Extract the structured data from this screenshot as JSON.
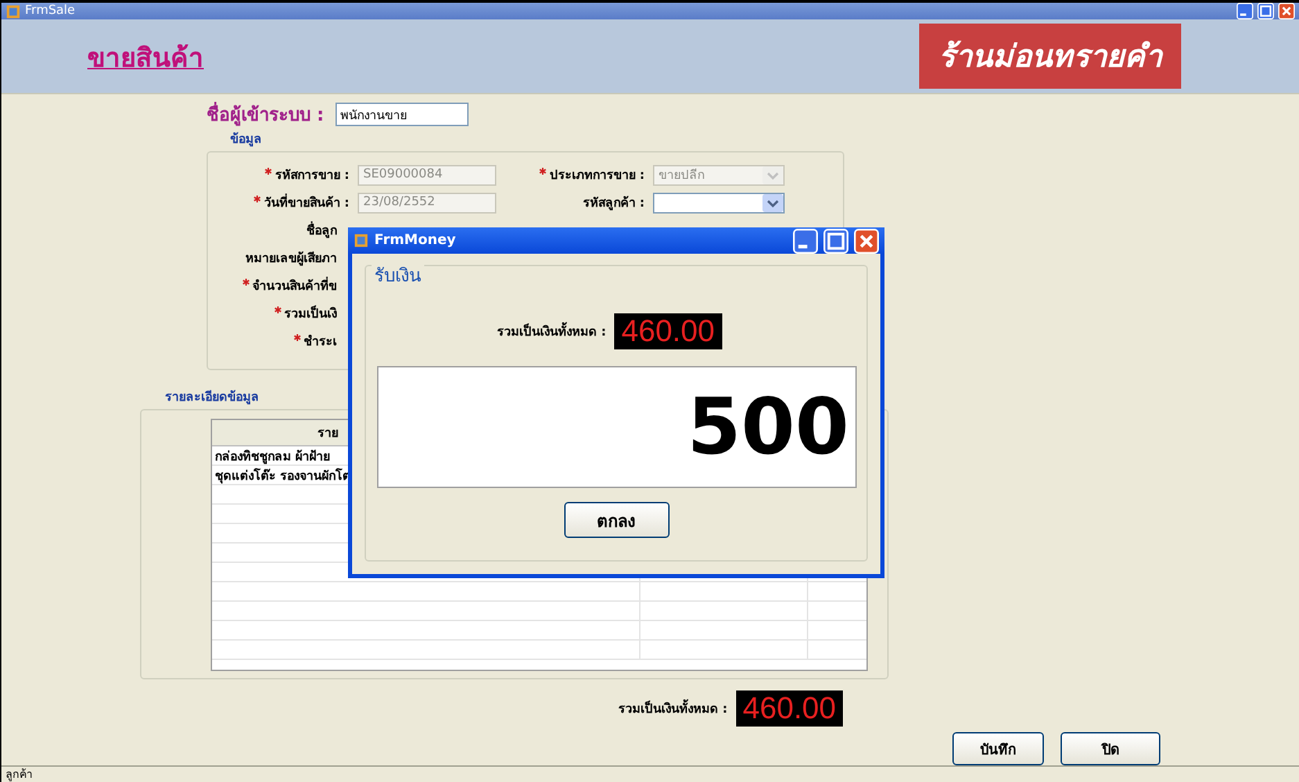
{
  "window": {
    "title": "FrmSale"
  },
  "banner": {
    "title": "ขายสินค้า",
    "shop_name": "ร้านม่อนทรายคำ"
  },
  "login": {
    "label": "ชื่อผู้เข้าระบบ :",
    "value": "พนักงานขาย"
  },
  "info_group": {
    "title": "ข้อมูล",
    "left_rows": [
      {
        "label": "รหัสการขาย :",
        "required": true,
        "value": "SE09000084",
        "disabled": true
      },
      {
        "label": "วันที่ขายสินค้า :",
        "required": true,
        "value": "23/08/2552",
        "disabled": true
      },
      {
        "label": "ชื่อลูก",
        "required": false
      },
      {
        "label": "หมายเลขผู้เสียภา",
        "required": false
      },
      {
        "label": "จำนวนสินค้าที่ข",
        "required": true
      },
      {
        "label": "รวมเป็นเงิ",
        "required": true
      },
      {
        "label": "ชำระเ",
        "required": true
      }
    ],
    "right_rows": [
      {
        "label": "ประเภทการขาย :",
        "required": true,
        "value": "ขายปลีก",
        "disabled": true
      },
      {
        "label": "รหัสลูกค้า :",
        "required": false,
        "value": "",
        "disabled": false
      }
    ]
  },
  "detail_group": {
    "title": "รายละเอียดข้อมูล",
    "column_1": "ราย",
    "rows": [
      "กล่องทิชชูกลม ผ้าฝ้าย",
      "ชุดแต่งโต๊ะ รองจานผักโต"
    ]
  },
  "total": {
    "label": "รวมเป็นเงินทั้งหมด :",
    "value": "460.00"
  },
  "buttons": [
    "บันทึก",
    "ปิด"
  ],
  "status_bar": "ลูกค้า",
  "dialog": {
    "title": "FrmMoney",
    "group_title": "รับเงิน",
    "total_label": "รวมเป็นเงินทั้งหมด :",
    "total_value": "460.00",
    "amount": "500",
    "ok_button": "ตกลง"
  }
}
